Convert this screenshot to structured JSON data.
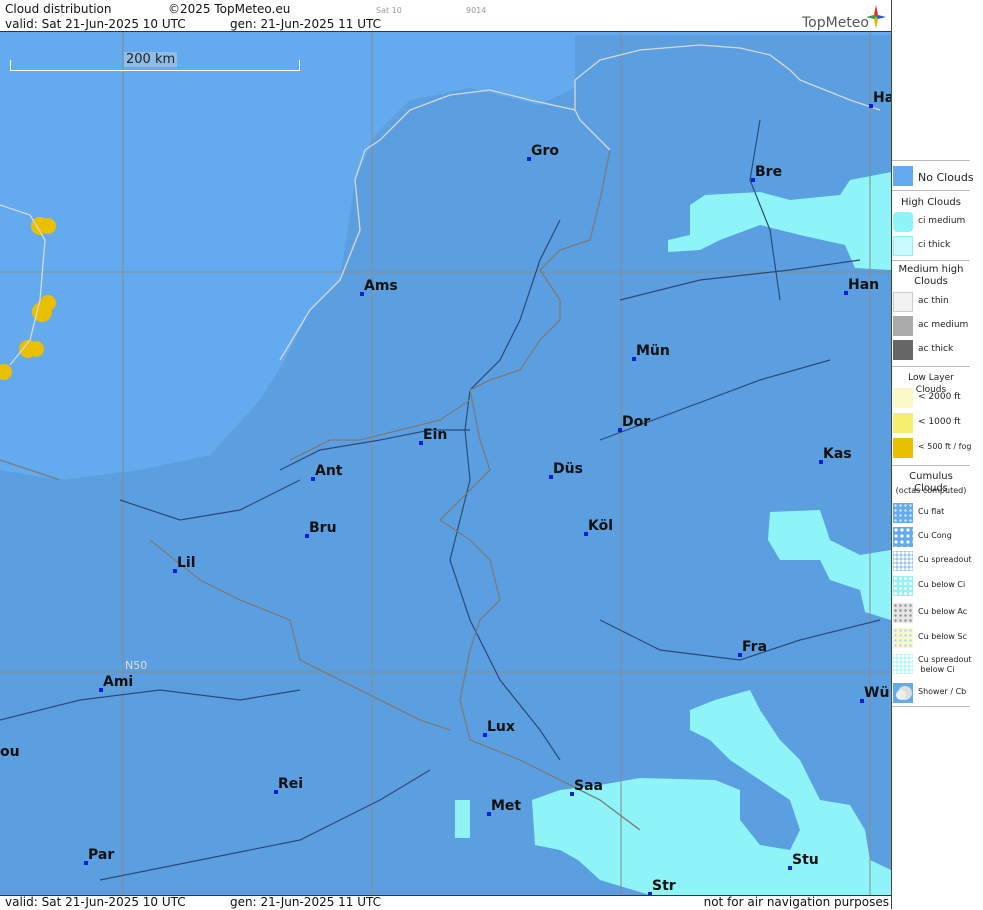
{
  "header": {
    "title": "Cloud distribution",
    "copyright": "©2025 TopMeteo.eu",
    "sat_code": "Sat 10",
    "code": "9014",
    "valid": "valid:  Sat  21-Jun-2025  10 UTC",
    "gen": "gen: 21-Jun-2025 11 UTC",
    "logo": "TopMeteo"
  },
  "footer": {
    "valid": "valid:  Sat  21-Jun-2025  10 UTC",
    "gen": "gen: 21-Jun-2025 11 UTC",
    "note": "not for air navigation purposes"
  },
  "map": {
    "scale_label": "200 km",
    "grid_label": "N50",
    "cities": [
      "Ha",
      "Gro",
      "Bre",
      "Ams",
      "Han",
      "Mün",
      "Ein",
      "Dor",
      "Ant",
      "Düs",
      "Kas",
      "Köl",
      "Bru",
      "Lil",
      "Fra",
      "Ami",
      "Wü",
      "Lux",
      "ou",
      "Rei",
      "Saa",
      "Met",
      "Par",
      "Stu",
      "Str"
    ]
  },
  "legend": {
    "no_clouds": "No Clouds",
    "high_title": "High Clouds",
    "ci_medium": "ci medium",
    "ci_thick": "ci thick",
    "medium_title_1": "Medium high",
    "medium_title_2": "Clouds",
    "ac_thin": "ac thin",
    "ac_medium": "ac medium",
    "ac_thick": "ac thick",
    "low_title": "Low Layer Clouds",
    "low_2000": "< 2000 ft",
    "low_1000": "< 1000 ft",
    "low_500": "< 500 ft / fog",
    "cu_title": "Cumulus Clouds",
    "cu_sub": "(octas computed)",
    "cu_flat": "Cu flat",
    "cu_cong": "Cu Cong",
    "cu_spreadout": "Cu spreadout",
    "cu_below_ci": "Cu below Ci",
    "cu_below_ac": "Cu below Ac",
    "cu_below_sc": "Cu below Sc",
    "cu_spread_ci_1": "Cu spreadout",
    "cu_spread_ci_2": "below Ci",
    "shower": "Shower / Cb"
  },
  "colors": {
    "no_clouds": "#63abee",
    "ci_medium": "#8ef4f7",
    "low_fog": "#e8c000",
    "ac_medium": "#aaaaaa",
    "ac_thick": "#666666",
    "city_dot": "#0a1fd6"
  }
}
